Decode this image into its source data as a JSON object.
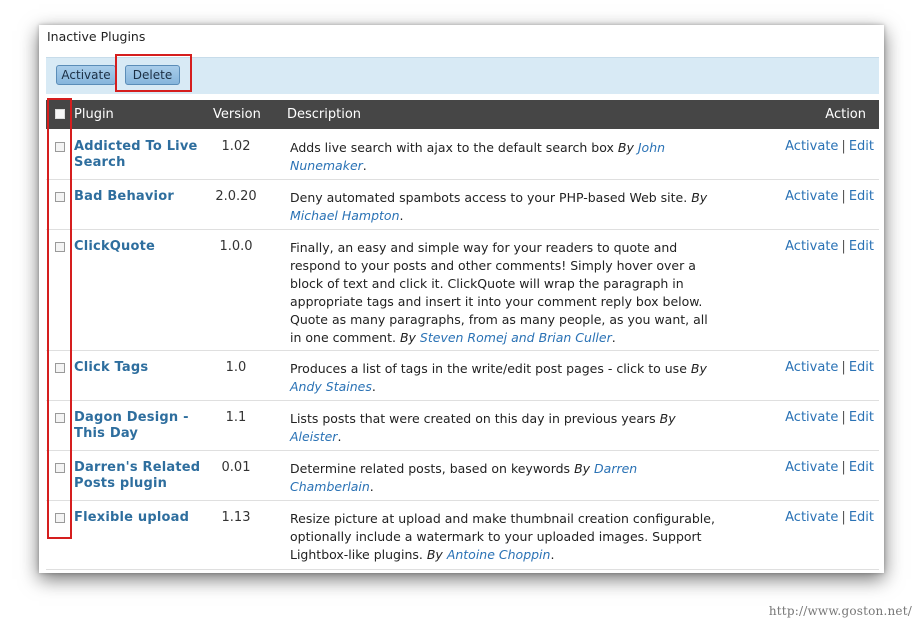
{
  "section_title": "Inactive Plugins",
  "toolbar": {
    "activate_label": "Activate",
    "delete_label": "Delete"
  },
  "table": {
    "headers": {
      "plugin": "Plugin",
      "version": "Version",
      "description": "Description",
      "action": "Action"
    },
    "rows": [
      {
        "name": "Addicted To Live Search",
        "version": "1.02",
        "description": "Adds live search with ajax to the default search box",
        "by": "By",
        "author": "John Nunemaker",
        "activate": "Activate",
        "edit": "Edit"
      },
      {
        "name": "Bad Behavior",
        "version": "2.0.20",
        "description": "Deny automated spambots access to your PHP-based Web site.",
        "by": "By",
        "author": "Michael Hampton",
        "activate": "Activate",
        "edit": "Edit"
      },
      {
        "name": "ClickQuote",
        "version": "1.0.0",
        "description": "Finally, an easy and simple way for your readers to quote and respond to your posts and other comments! Simply hover over a block of text and click it. ClickQuote will wrap the paragraph in appropriate tags and insert it into your comment reply box below. Quote as many paragraphs, from as many people, as you want, all in one comment.",
        "by": "By",
        "author": "Steven Romej and Brian Culler",
        "activate": "Activate",
        "edit": "Edit"
      },
      {
        "name": "Click Tags",
        "version": "1.0",
        "description": "Produces a list of tags in the write/edit post pages - click to use",
        "by": "By",
        "author": "Andy Staines",
        "activate": "Activate",
        "edit": "Edit"
      },
      {
        "name": "Dagon Design - This Day",
        "version": "1.1",
        "description": "Lists posts that were created on this day in previous years",
        "by": "By",
        "author": "Aleister",
        "activate": "Activate",
        "edit": "Edit"
      },
      {
        "name": "Darren's Related Posts plugin",
        "version": "0.01",
        "description": "Determine related posts, based on keywords",
        "by": "By",
        "author": "Darren Chamberlain",
        "activate": "Activate",
        "edit": "Edit"
      },
      {
        "name": "Flexible upload",
        "version": "1.13",
        "description": "Resize picture at upload and make thumbnail creation configurable, optionally include a watermark to your uploaded images. Support Lightbox-like plugins.",
        "by": "By",
        "author": "Antoine Choppin",
        "activate": "Activate",
        "edit": "Edit"
      }
    ]
  },
  "watermark": "http://www.goston.net/",
  "colors": {
    "header_bg": "#464646",
    "toolbar_bg": "#d8eaf5",
    "link": "#2a72b5",
    "highlight": "#d51e1e"
  }
}
